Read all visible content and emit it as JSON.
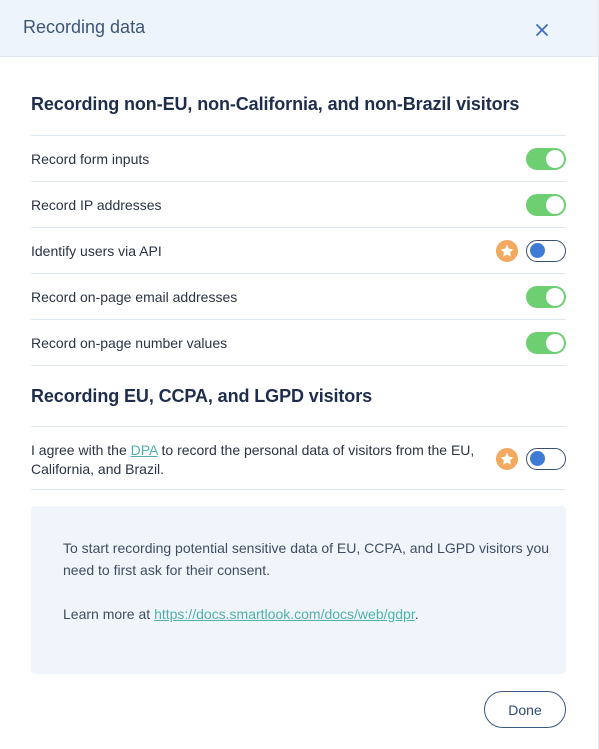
{
  "dialog": {
    "title": "Recording data",
    "close_icon": "close-icon"
  },
  "section_non_eu": {
    "title": "Recording non-EU, non-California, and non-Brazil visitors",
    "settings": [
      {
        "label": "Record form inputs",
        "enabled": true,
        "premium": false
      },
      {
        "label": "Record IP addresses",
        "enabled": true,
        "premium": false
      },
      {
        "label": "Identify users via API",
        "enabled": false,
        "premium": true
      },
      {
        "label": "Record on-page email addresses",
        "enabled": true,
        "premium": false
      },
      {
        "label": "Record on-page number values",
        "enabled": true,
        "premium": false
      }
    ]
  },
  "section_eu": {
    "title": "Recording EU, CCPA, and LGPD visitors",
    "agree_prefix": "I agree with the ",
    "agree_link": "DPA",
    "agree_suffix_line1": " to record the personal data of visitors from the EU,",
    "agree_line2": "California, and Brazil.",
    "enabled": false,
    "premium": true
  },
  "info": {
    "line1": "To start recording potential sensitive data of EU, CCPA, and LGPD visitors you",
    "line2": "need to first ask for their consent.",
    "learn_more_prefix": "Learn more at ",
    "learn_more_link": "https://docs.smartlook.com/docs/web/gdpr",
    "learn_more_suffix": "."
  },
  "footer": {
    "done_label": "Done"
  },
  "colors": {
    "toggle_on": "#6ecf72",
    "toggle_off_knob": "#3d7bd4",
    "premium_badge": "#f3a960",
    "link": "#4fb0aa",
    "header_bg": "#eef4fb"
  }
}
